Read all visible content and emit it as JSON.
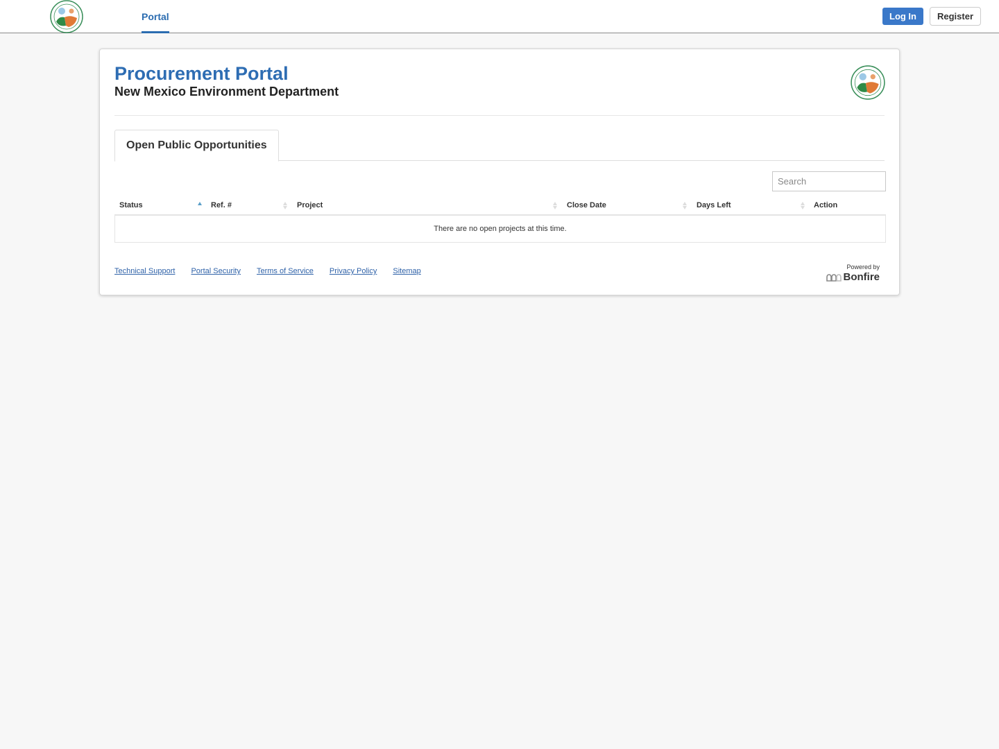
{
  "nav": {
    "logo_alt": "New Mexico Environment Department seal",
    "portal_tab": "Portal",
    "login_label": "Log In",
    "register_label": "Register"
  },
  "header": {
    "title": "Procurement Portal",
    "subtitle": "New Mexico Environment Department"
  },
  "tabs": [
    {
      "label": "Open Public Opportunities",
      "active": true
    }
  ],
  "search": {
    "placeholder": "Search",
    "value": ""
  },
  "table": {
    "columns": [
      {
        "label": "Status",
        "sort": "asc"
      },
      {
        "label": "Ref. #",
        "sort": "none"
      },
      {
        "label": "Project",
        "sort": "none"
      },
      {
        "label": "Close Date",
        "sort": "none"
      },
      {
        "label": "Days Left",
        "sort": "none"
      },
      {
        "label": "Action",
        "sort": "none"
      }
    ],
    "rows": [],
    "empty_message": "There are no open projects at this time."
  },
  "footer": {
    "links": [
      "Technical Support",
      "Portal Security",
      "Terms of Service",
      "Privacy Policy",
      "Sitemap"
    ],
    "powered_by": "Powered by",
    "brand": "Bonfire"
  },
  "colors": {
    "accent": "#2e6db3",
    "login_button": "#3a78c9",
    "link": "#2f62a8",
    "sort_active": "#5b9fc8"
  }
}
